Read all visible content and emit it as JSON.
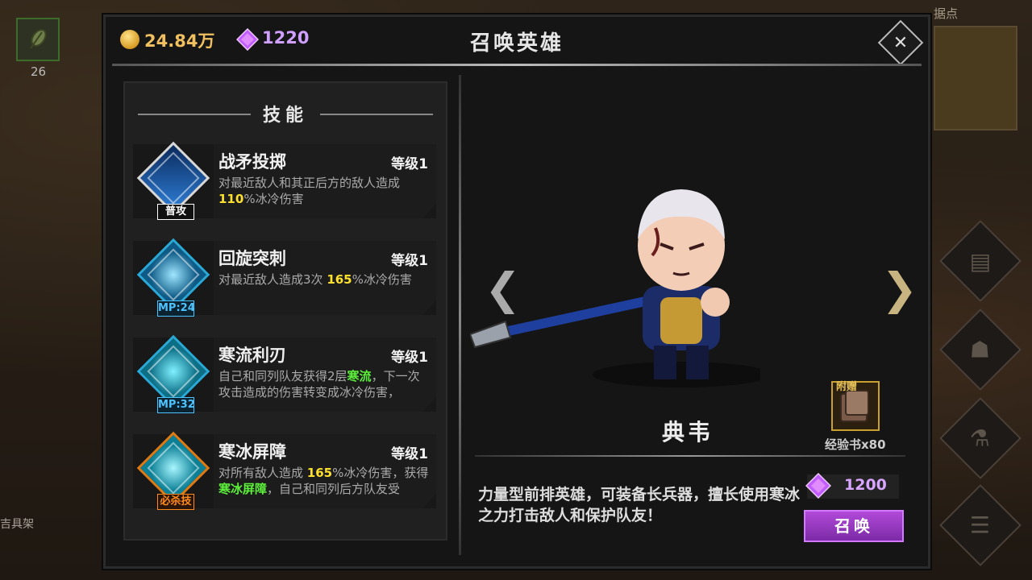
{
  "world": {
    "item_count": "26",
    "left_label": "吉具架",
    "map_title": "据点"
  },
  "currency": {
    "gold": "24.84万",
    "gems": "1220"
  },
  "title": "召唤英雄",
  "skills_header": "技能",
  "skills": [
    {
      "name": "战矛投掷",
      "level": "等级1",
      "badge": "普攻",
      "desc_a": "对最近敌人和其正后方的敌人造成 ",
      "desc_hl": "110",
      "desc_b": "%冰冷伤害",
      "gem_color": "#d8d8d8",
      "badge_color": "#ffffff"
    },
    {
      "name": "回旋突刺",
      "level": "等级1",
      "badge": "MP:24",
      "desc_a": "对最近敌人造成3次 ",
      "desc_hl": "165",
      "desc_b": "%冰冷伤害",
      "gem_color": "#2aa8d6",
      "badge_color": "#4cc3ff"
    },
    {
      "name": "寒流利刃",
      "level": "等级1",
      "badge": "MP:32",
      "desc_a": "自己和同列队友获得2层",
      "desc_hl": "寒流",
      "desc_b": "，下一次攻击造成的伤害转变成冰冷伤害，",
      "gem_color": "#2aa8d6",
      "badge_color": "#4cc3ff"
    },
    {
      "name": "寒冰屏障",
      "level": "等级1",
      "badge": "必杀技",
      "desc_a": "对所有敌人造成 ",
      "desc_hl": "165",
      "desc_b": "%冰冷伤害，获",
      "desc_c": "得",
      "desc_hl2": "寒冰屏障",
      "desc_d": "，自己和同列后方队友受",
      "gem_color": "#e07a12",
      "badge_color": "#ff8a1e"
    }
  ],
  "hero": {
    "name": "典韦",
    "prev_arrow": "❮",
    "next_arrow": "❯",
    "gift_label": "附赠",
    "gift_item": "经验书x80",
    "description": "力量型前排英雄，可装备长兵器，擅长使用寒冰之力打击敌人和保护队友！",
    "price": "1200",
    "summon_label": "召唤"
  },
  "colors": {
    "gem": "#c15cff",
    "gold": "#f0c060",
    "accent_purple": "#9a3cc9"
  }
}
